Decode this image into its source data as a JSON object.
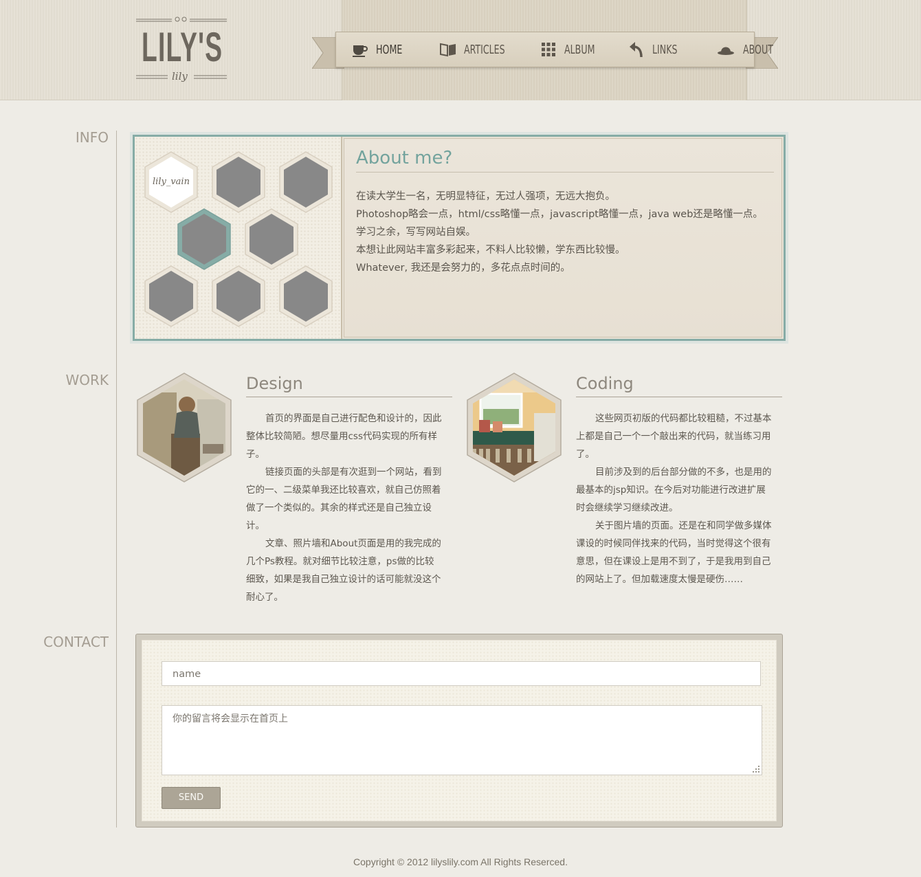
{
  "brand": {
    "logo_text": "LILY'S",
    "logo_sub": "lily"
  },
  "nav": {
    "items": [
      {
        "label": "HOME",
        "icon": "coffee-cup-icon"
      },
      {
        "label": "ARTICLES",
        "icon": "open-book-icon"
      },
      {
        "label": "ALBUM",
        "icon": "grid-dots-icon"
      },
      {
        "label": "LINKS",
        "icon": "curved-arrow-icon"
      },
      {
        "label": "ABOUT",
        "icon": "hat-icon"
      }
    ]
  },
  "sections": {
    "info": "INFO",
    "work": "WORK",
    "contact": "CONTACT"
  },
  "info": {
    "avatar_text": "lily_vain",
    "about_title": "About me?",
    "about_lines": [
      "在读大学生一名，无明显特征，无过人强项，无远大抱负。",
      "Photoshop略会一点，html/css略懂一点，javascript略懂一点，java web还是略懂一点。",
      "学习之余，写写网站自娱。",
      "本想让此网站丰富多彩起来，不料人比较懒，学东西比较慢。",
      "Whatever, 我还是会努力的，多花点点时间的。"
    ]
  },
  "work": {
    "design": {
      "title": "Design",
      "paragraphs": [
        "首页的界面是自己进行配色和设计的，因此整体比较简陋。想尽量用css代码实现的所有样子。",
        "链接页面的头部是有次逛到一个网站，看到它的一、二级菜单我还比较喜欢，就自己仿照着做了一个类似的。其余的样式还是自己独立设计。",
        "文章、照片墙和About页面是用的我完成的几个Ps教程。就对细节比较注意，ps做的比较细致，如果是我自己独立设计的话可能就没这个耐心了。"
      ]
    },
    "coding": {
      "title": "Coding",
      "paragraphs": [
        "这些网页初版的代码都比较粗糙，不过基本上都是自己一个一个敲出来的代码，就当练习用了。",
        "目前涉及到的后台部分做的不多，也是用的最基本的jsp知识。在今后对功能进行改进扩展时会继续学习继续改进。",
        "关于图片墙的页面。还是在和同学做多媒体课设的时候同伴找来的代码，当时觉得这个很有意思，但在课设上是用不到了，于是我用到自己的网站上了。但加载速度太慢是硬伤……"
      ]
    }
  },
  "contact": {
    "name_placeholder": "name",
    "message_placeholder": "你的留言将会显示在首页上",
    "send_label": "SEND"
  },
  "footer": {
    "copyright": "Copyright © 2012 lilyslily.com All Rights Reserced."
  },
  "colors": {
    "accent": "#86aca6",
    "title": "#73a39d",
    "background": "#eeece6"
  }
}
